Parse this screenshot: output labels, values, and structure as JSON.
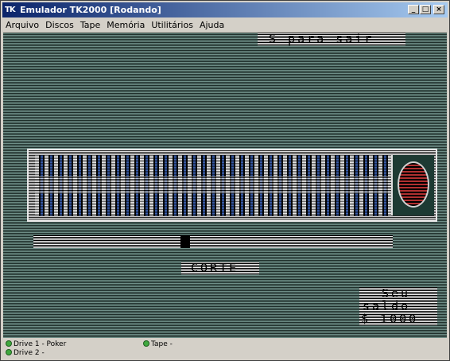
{
  "window": {
    "icon_text": "TK",
    "title": "Emulador TK2000 [Rodando]",
    "controls": {
      "minimize": "_",
      "maximize": "□",
      "close": "×"
    }
  },
  "menu": [
    "Arquivo",
    "Discos",
    "Tape",
    "Memória",
    "Utilitários",
    "Ajuda"
  ],
  "screen": {
    "exit_hint": "S para sair",
    "action_label": "CORTE",
    "balance_label_1": "Seu",
    "balance_label_2": "saldo",
    "balance_value": "$ 1000",
    "cut_position": 0.42
  },
  "status": {
    "drive1": "Drive 1 - Poker",
    "drive2": "Drive 2 -",
    "tape": "Tape -"
  },
  "colors": {
    "screen_bg": "#3a5a50",
    "led_on": "#3fa83f",
    "card_back": "#8b1f1f"
  }
}
